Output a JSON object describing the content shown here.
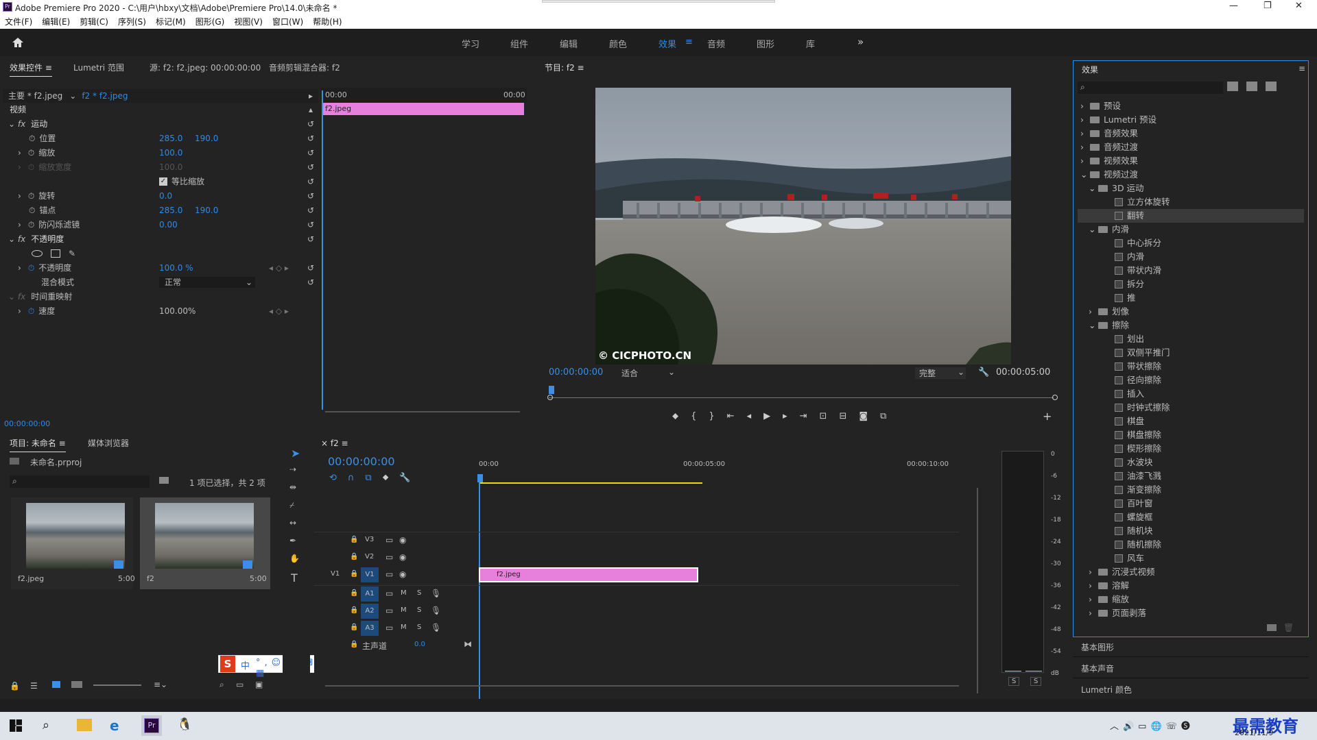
{
  "window": {
    "title": "Adobe Premiere Pro 2020 - C:\\用户\\hbxy\\文档\\Adobe\\Premiere Pro\\14.0\\未命名 *",
    "controls": [
      "—",
      "❐",
      "✕"
    ]
  },
  "menu": [
    "文件(F)",
    "编辑(E)",
    "剪辑(C)",
    "序列(S)",
    "标记(M)",
    "图形(G)",
    "视图(V)",
    "窗口(W)",
    "帮助(H)"
  ],
  "workspaces": [
    "学习",
    "组件",
    "编辑",
    "颜色",
    "效果",
    "音频",
    "图形",
    "库"
  ],
  "workspace_active": "效果",
  "effect_controls": {
    "tabs": [
      "效果控件",
      "Lumetri 范围",
      "源: f2: f2.jpeg: 00:00:00:00",
      "音频剪辑混合器: f2"
    ],
    "master": "主要 * f2.jpeg",
    "clip": "f2 * f2.jpeg",
    "time_start": "00:00",
    "time_end": "00:00",
    "clip_name": "f2.jpeg",
    "section_video": "视频",
    "motion": "运动",
    "position_label": "位置",
    "position_x": "285.0",
    "position_y": "190.0",
    "scale_label": "缩放",
    "scale": "100.0",
    "scale_w_label": "缩放宽度",
    "scale_w": "100.0",
    "uniform_label": "等比缩放",
    "rotation_label": "旋转",
    "rotation": "0.0",
    "anchor_label": "锚点",
    "anchor_x": "285.0",
    "anchor_y": "190.0",
    "flicker_label": "防闪烁滤镜",
    "flicker": "0.00",
    "opacity_section": "不透明度",
    "opacity_label": "不透明度",
    "opacity": "100.0 %",
    "blend_label": "混合模式",
    "blend": "正常",
    "remap_section": "时间重映射",
    "speed_label": "速度",
    "speed": "100.00%",
    "timecode": "00:00:00:00"
  },
  "program": {
    "title": "节目: f2",
    "watermark": "© CICPHOTO.CN",
    "timecode": "00:00:00:00",
    "fit": "适合",
    "quality": "完整",
    "duration": "00:00:05:00"
  },
  "project": {
    "tabs": [
      "项目: 未命名",
      "媒体浏览器"
    ],
    "file": "未命名.prproj",
    "selection": "1 项已选择，共 2 项",
    "items": [
      {
        "name": "f2.jpeg",
        "dur": "5:00"
      },
      {
        "name": "f2",
        "dur": "5:00"
      }
    ]
  },
  "timeline": {
    "tab": "f2",
    "timecode": "00:00:00:00",
    "ruler": [
      "00:00",
      "00:00:05:00",
      "00:00:10:00"
    ],
    "video_tracks": [
      "V3",
      "V2",
      "V1"
    ],
    "audio_tracks": [
      "A1",
      "A2",
      "A3"
    ],
    "source_v": "V1",
    "master_label": "主声道",
    "master_value": "0.0",
    "clip": "f2.jpeg"
  },
  "meter": {
    "scale": [
      "0",
      "-6",
      "-12",
      "-18",
      "-24",
      "-30",
      "-36",
      "-42",
      "-48",
      "-54",
      "dB"
    ],
    "solo": [
      "S",
      "S"
    ]
  },
  "effects": {
    "title": "效果",
    "tree": [
      {
        "label": "预设",
        "level": 0,
        "type": "folder"
      },
      {
        "label": "Lumetri 预设",
        "level": 0,
        "type": "folder"
      },
      {
        "label": "音频效果",
        "level": 0,
        "type": "folder"
      },
      {
        "label": "音频过渡",
        "level": 0,
        "type": "folder"
      },
      {
        "label": "视频效果",
        "level": 0,
        "type": "folder"
      },
      {
        "label": "视频过渡",
        "level": 0,
        "type": "folder",
        "open": true
      },
      {
        "label": "3D 运动",
        "level": 1,
        "type": "folder",
        "open": true
      },
      {
        "label": "立方体旋转",
        "level": 2,
        "type": "fx"
      },
      {
        "label": "翻转",
        "level": 2,
        "type": "fx",
        "selected": true
      },
      {
        "label": "内滑",
        "level": 1,
        "type": "folder",
        "open": true
      },
      {
        "label": "中心拆分",
        "level": 2,
        "type": "fx"
      },
      {
        "label": "内滑",
        "level": 2,
        "type": "fx"
      },
      {
        "label": "带状内滑",
        "level": 2,
        "type": "fx"
      },
      {
        "label": "拆分",
        "level": 2,
        "type": "fx"
      },
      {
        "label": "推",
        "level": 2,
        "type": "fx"
      },
      {
        "label": "划像",
        "level": 1,
        "type": "folder"
      },
      {
        "label": "擦除",
        "level": 1,
        "type": "folder",
        "open": true
      },
      {
        "label": "划出",
        "level": 2,
        "type": "fx"
      },
      {
        "label": "双侧平推门",
        "level": 2,
        "type": "fx"
      },
      {
        "label": "带状擦除",
        "level": 2,
        "type": "fx"
      },
      {
        "label": "径向擦除",
        "level": 2,
        "type": "fx"
      },
      {
        "label": "插入",
        "level": 2,
        "type": "fx"
      },
      {
        "label": "时钟式擦除",
        "level": 2,
        "type": "fx"
      },
      {
        "label": "棋盘",
        "level": 2,
        "type": "fx"
      },
      {
        "label": "棋盘擦除",
        "level": 2,
        "type": "fx"
      },
      {
        "label": "楔形擦除",
        "level": 2,
        "type": "fx"
      },
      {
        "label": "水波块",
        "level": 2,
        "type": "fx"
      },
      {
        "label": "油漆飞溅",
        "level": 2,
        "type": "fx"
      },
      {
        "label": "渐变擦除",
        "level": 2,
        "type": "fx"
      },
      {
        "label": "百叶窗",
        "level": 2,
        "type": "fx"
      },
      {
        "label": "螺旋框",
        "level": 2,
        "type": "fx"
      },
      {
        "label": "随机块",
        "level": 2,
        "type": "fx"
      },
      {
        "label": "随机擦除",
        "level": 2,
        "type": "fx"
      },
      {
        "label": "风车",
        "level": 2,
        "type": "fx"
      },
      {
        "label": "沉浸式视频",
        "level": 1,
        "type": "folder"
      },
      {
        "label": "溶解",
        "level": 1,
        "type": "folder"
      },
      {
        "label": "缩放",
        "level": 1,
        "type": "folder"
      },
      {
        "label": "页面剥落",
        "level": 1,
        "type": "folder"
      }
    ],
    "bottom": [
      "基本图形",
      "基本声音",
      "Lumetri 颜色"
    ]
  },
  "ime": {
    "logo": "S",
    "lang": "中"
  },
  "taskbar": {
    "time": "2021/11/9",
    "brand": "最需教育"
  },
  "colors": {
    "accent": "#2d8ceb",
    "clip": "#e680dc",
    "playhead": "#3b8fe6"
  }
}
